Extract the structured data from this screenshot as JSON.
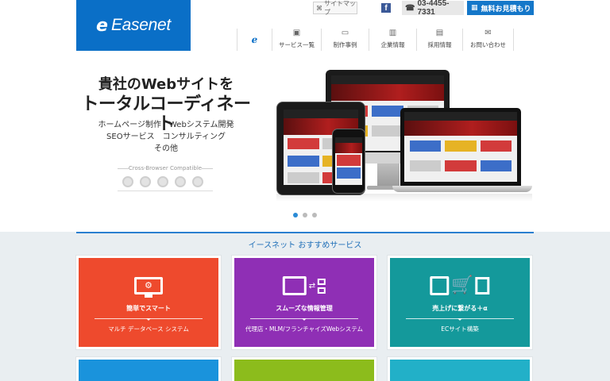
{
  "header": {
    "logo_mark": "e",
    "logo_text": "Easenet",
    "sitemap_label": "サイトマップ",
    "facebook_glyph": "f",
    "tel": "03-4455-7331",
    "estimate_label": "無料お見積もり"
  },
  "nav": {
    "home_mark": "ℯ",
    "items": [
      {
        "label": "サービス一覧",
        "icon": "briefcase-icon"
      },
      {
        "label": "制作事例",
        "icon": "monitor-icon"
      },
      {
        "label": "企業情報",
        "icon": "building-icon"
      },
      {
        "label": "採用情報",
        "icon": "id-card-icon"
      },
      {
        "label": "お問い合わせ",
        "icon": "envelope-icon"
      }
    ]
  },
  "hero": {
    "title_line1": "貴社のWebサイトを",
    "title_line2": "トータルコーディネート",
    "services_line1": "ホームページ制作　Webシステム開発",
    "services_line2": "SEOサービス　コンサルティング",
    "services_line3": "その他",
    "cross_browser_label": "Cross-Browser Compatible",
    "browsers": [
      "chrome-icon",
      "safari-icon",
      "firefox-icon",
      "ie-icon",
      "opera-icon"
    ],
    "slide_count": 3,
    "active_slide": 1
  },
  "section": {
    "title": "イースネット おすすめサービス"
  },
  "cards": [
    {
      "main": "簡単でスマート",
      "sub": "マルチ データベース システム",
      "color": "#ee4a2d"
    },
    {
      "main": "スムーズな情報管理",
      "sub": "代理店・MLM/フランチャイズWebシステム",
      "color": "#8f2fb5"
    },
    {
      "main": "売上げに繋がる＋α",
      "sub": "ECサイト構築",
      "color": "#14999b"
    }
  ],
  "colors": {
    "brand": "#0a6fc7",
    "accent_blue": "#1477c9",
    "section_bg": "#e9eef1"
  }
}
